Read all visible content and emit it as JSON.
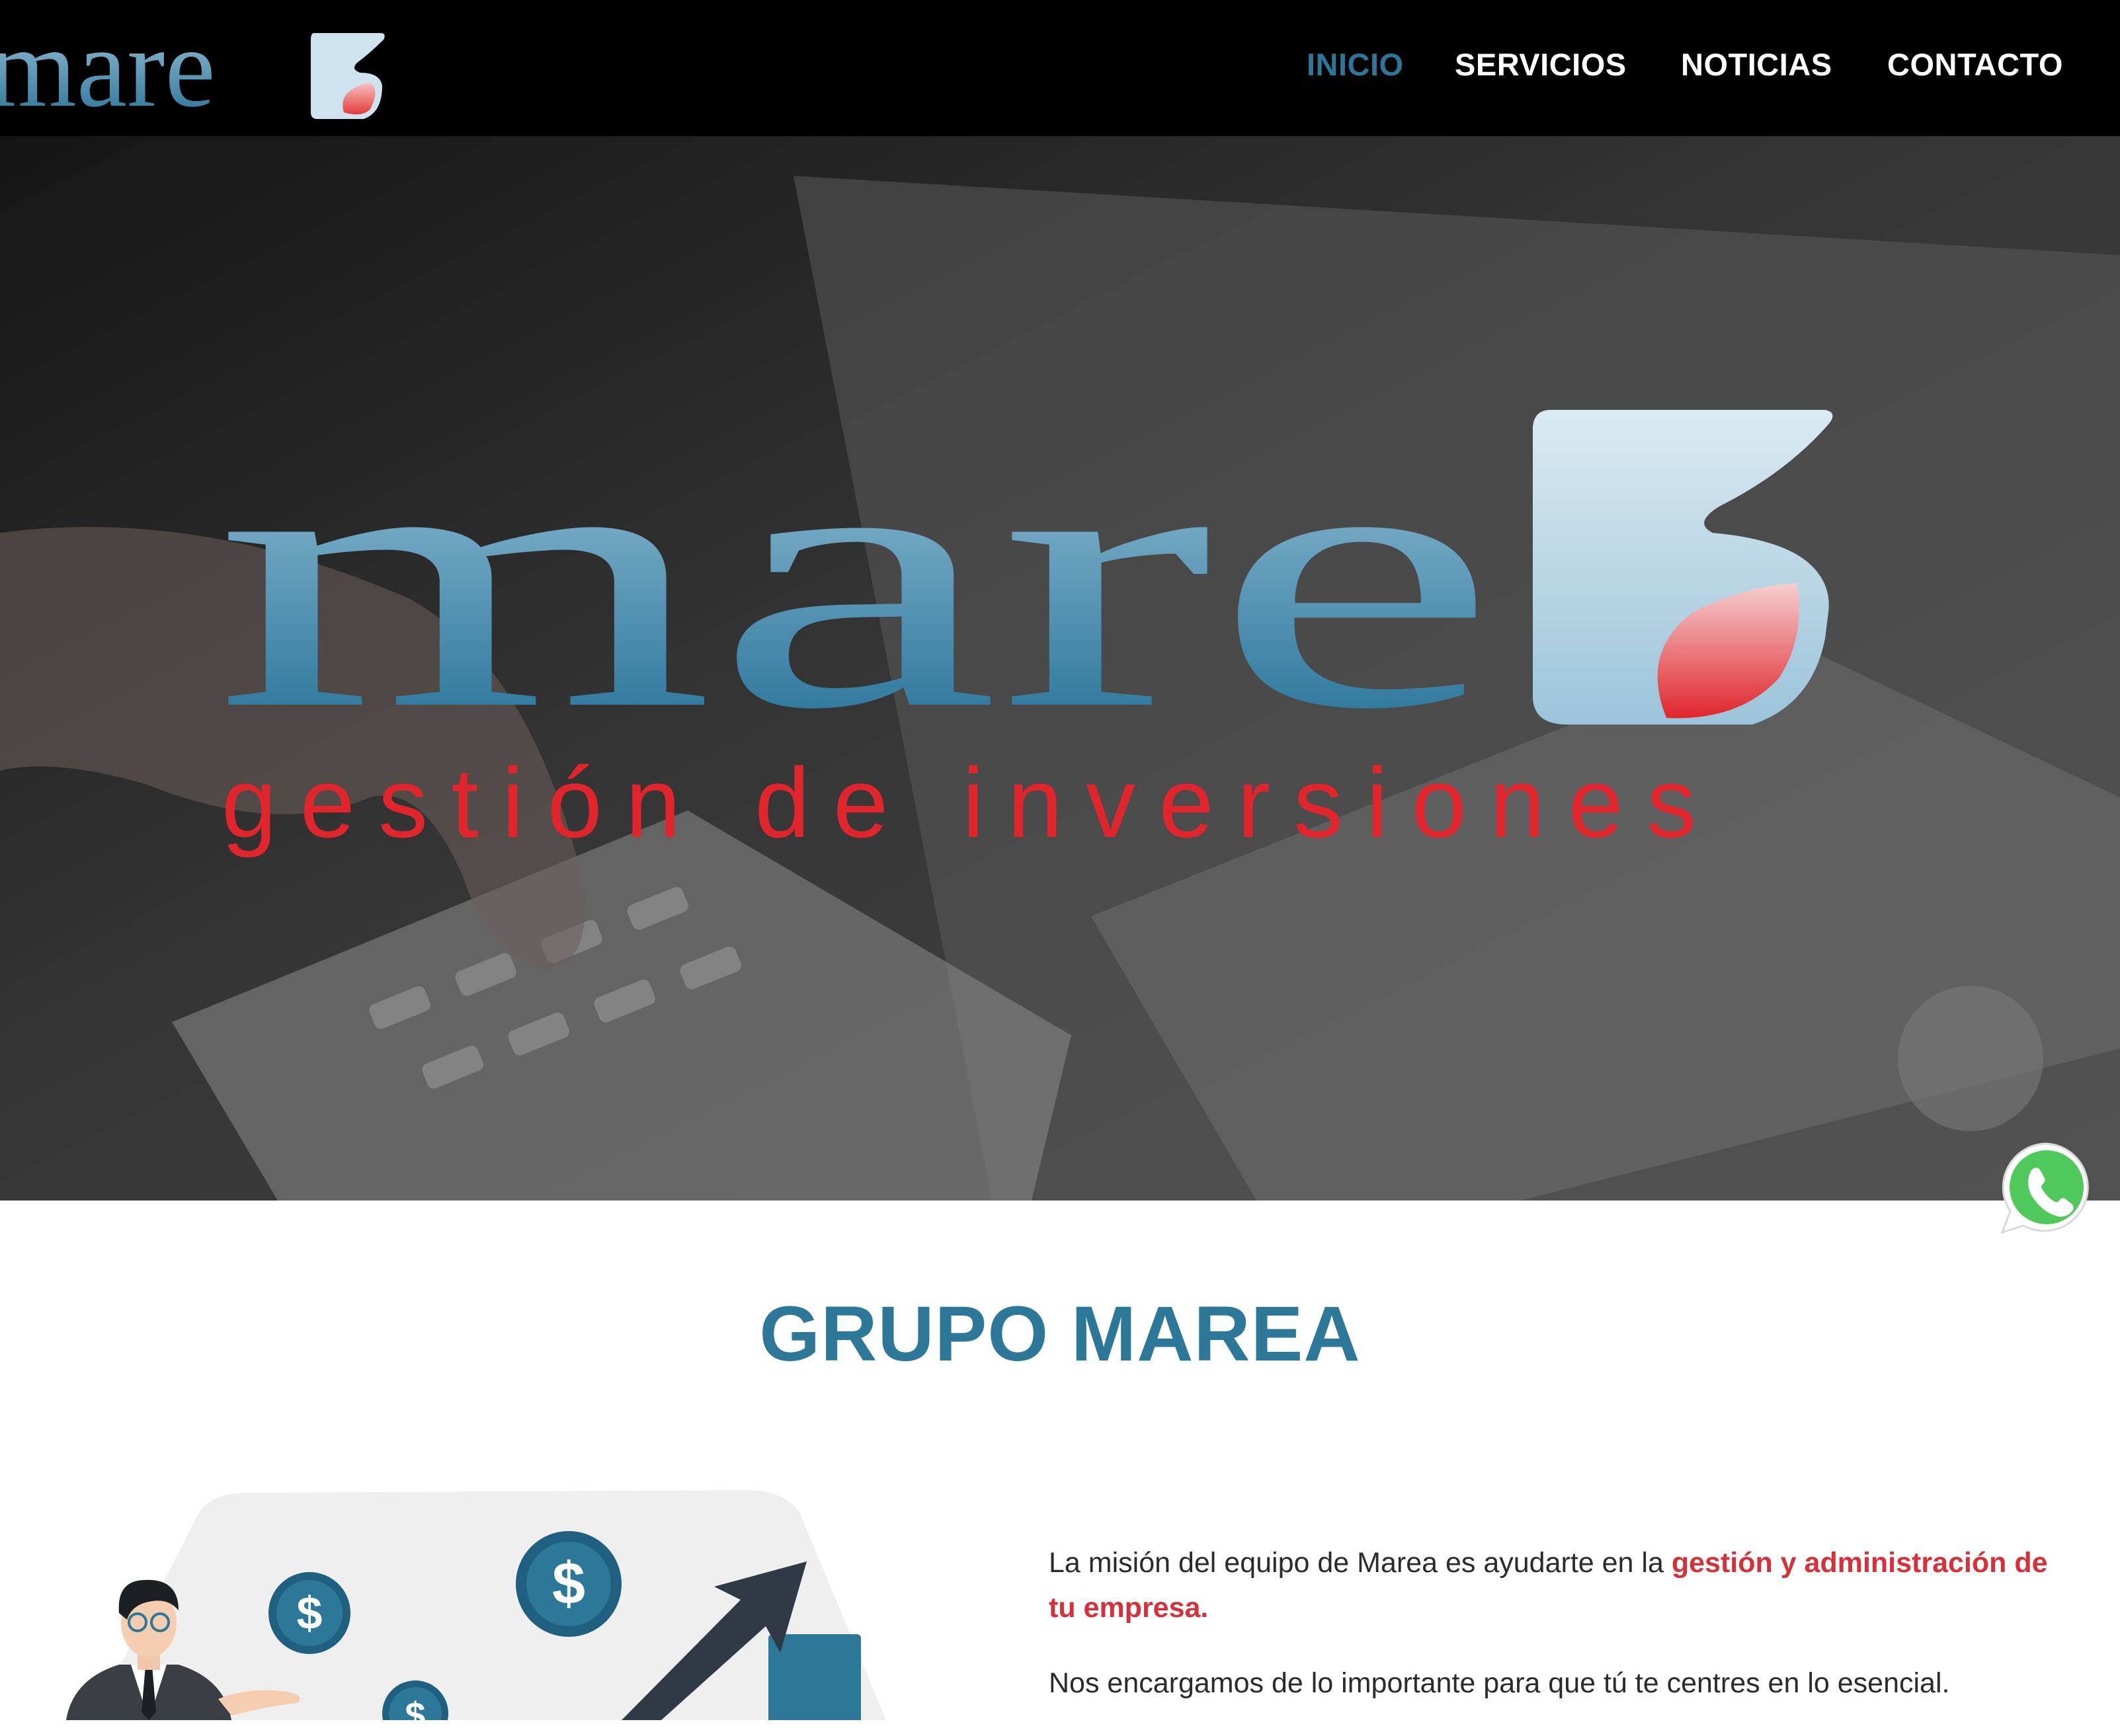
{
  "brand": {
    "logo_text": "mare",
    "hero_logo_text": "mare",
    "hero_tagline": "gestión de inversiones"
  },
  "nav": {
    "items": [
      {
        "label": "INICIO",
        "active": true
      },
      {
        "label": "SERVICIOS",
        "active": false
      },
      {
        "label": "NOTICIAS",
        "active": false
      },
      {
        "label": "CONTACTO",
        "active": false
      }
    ]
  },
  "section": {
    "title": "GRUPO MAREA",
    "p1_before": "La misión del equipo de Marea es ayudarte en la ",
    "p1_highlight": "gestión y administración de tu empresa.",
    "p2": "Nos encargamos de lo importante para que tú te centres en lo esencial."
  },
  "illustration": {
    "coin_symbol": "$"
  },
  "icons": {
    "whatsapp": "whatsapp-icon"
  },
  "colors": {
    "brand_blue": "#2d7799",
    "accent_red": "#d6303b",
    "nav_bg": "#000000",
    "whatsapp_green": "#4fc95a"
  }
}
